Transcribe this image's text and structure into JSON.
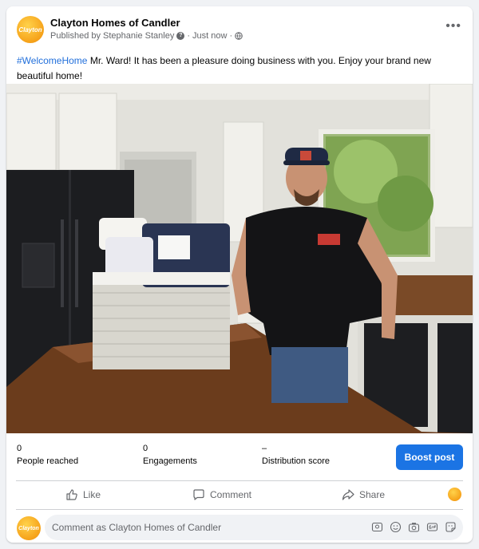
{
  "header": {
    "page_name": "Clayton Homes of Candler",
    "published_by": "Published by Stephanie Stanley",
    "time": "Just now",
    "avatar_text": "Clayton"
  },
  "post": {
    "hashtag": "#WelcomeHome",
    "text": " Mr. Ward!  It has been a pleasure doing business with you.  Enjoy your brand new beautiful home!"
  },
  "stats": {
    "people_reached": {
      "value": "0",
      "label": "People reached"
    },
    "engagements": {
      "value": "0",
      "label": "Engagements"
    },
    "distribution": {
      "value": "–",
      "label": "Distribution score"
    },
    "boost_label": "Boost post"
  },
  "actions": {
    "like": "Like",
    "comment": "Comment",
    "share": "Share"
  },
  "comment": {
    "placeholder": "Comment as Clayton Homes of Candler",
    "avatar_text": "Clayton"
  },
  "colors": {
    "boost": "#1b74e4",
    "hashtag": "#216fdb",
    "brand_orange": "#f6a21a"
  }
}
